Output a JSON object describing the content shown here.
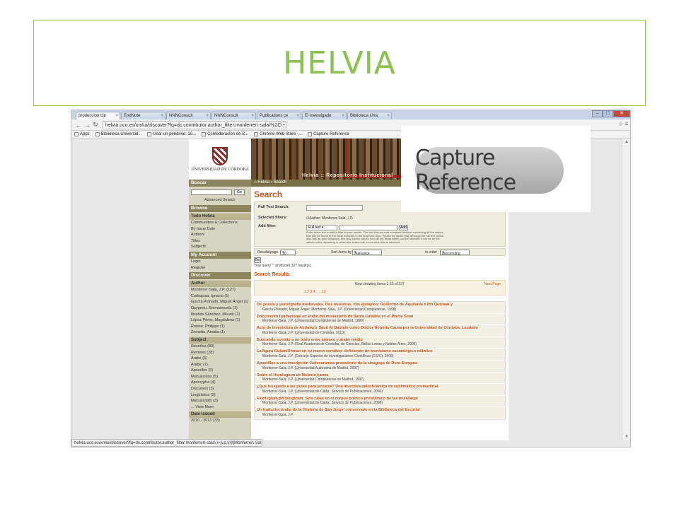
{
  "slide": {
    "title": "HELVIA"
  },
  "browser": {
    "tabs": [
      {
        "label": "produccion cie"
      },
      {
        "label": "EndNote"
      },
      {
        "label": "NNNConsult"
      },
      {
        "label": "NNNConsult"
      },
      {
        "label": "Publications ce"
      },
      {
        "label": "El investigado"
      },
      {
        "label": "Biblioteca Univ"
      }
    ],
    "url": "helvia.uco.es/xmlui/discover?fq=dc.contributor.author_filter:monferrer\\-sala\\%2C\\+j\\.p.\\|\\|\\|Monferrer\\-Sala\\%2C\\+J.P.",
    "bookmarks": [
      "Apps",
      "Biblioteca Universid...",
      "Usar un pendrive: 10...",
      "Confederación de S...",
      "Chrome Web Store -...",
      "Capture Reference"
    ],
    "status_url": "helvia.uco.es/xmlui/discover?fq=dc.contributor.author_filter:monferrer\\-sala\\,\\+j\\.p.\\|\\|\\|Monferrer\\-Sala\\,\\+J.P."
  },
  "site": {
    "logo_text": "UNIVERSIDAD DE CÓRDOBA",
    "banner_title": "Helvia :: Repositorio Institucional",
    "breadcrumb": [
      "Helvia",
      "Search"
    ]
  },
  "sidebar": {
    "buscar": "Buscar",
    "go": "Go",
    "advanced": "Advanced Search",
    "browse": "Browse",
    "todo_helvia": "Todo Helvia",
    "browse_items": [
      "Communities & Collections",
      "By Issue Date",
      "Authors",
      "Titles",
      "Subjects"
    ],
    "my_account": "My Account",
    "account_items": [
      "Login",
      "Register"
    ],
    "discover": "Discover",
    "author": "Author",
    "author_items": [
      "Monferrer-Sala, J.P. (127)",
      "Carbajosa, Ignacio (1)",
      "García Peinado, Miguel Ángel (1)",
      "Gzypeou, Emmanouela (1)",
      "Ibrahim Sánchez, Mounir (1)",
      "López Pérez, Magdalena (1)",
      "Roisse, Philippe (1)",
      "Zomeño, Amalia (1)"
    ],
    "subject": "Subject",
    "subject_items": [
      "Reseñas (83)",
      "Reviews (28)",
      "Árabe (6)",
      "Arabic (7)",
      "Apócrifos (5)",
      "Manuscritos (5)",
      "Apocrypha (4)",
      "Discursos (3)",
      "Lingüística (3)",
      "Manuscripts (3)",
      "... View More"
    ],
    "date_issued": "Date Issued",
    "date_items": [
      "2010 - 2013 (33)"
    ]
  },
  "main": {
    "heading": "Search",
    "full_text_label": "Full Text Search:",
    "selected_filters_label": "Selected filters:",
    "selected_filter_value": "Author: Monferrer-Sala, J.P.",
    "add_filter_label": "Add filter:",
    "add_filter_select": "Full text",
    "add_button": "Add",
    "filter_help": "Enter some text to add a filter to your results. The box has an auto-complete function containing all the values that can be found in the fields selected in the dropdown box. Please be aware that although the full text option also has an auto complete, this only shows values from all the fields which can be selected & not for all the values in the repository in which the search will occur when this is selected.",
    "results_page_label": "Results/page",
    "results_page_value": "10",
    "sort_label": "Sort items by",
    "sort_value": "relevance",
    "order_label": "in order",
    "order_value": "descending",
    "go_button": "Go",
    "query_text": "Your query \"\" produced 127 result(s).",
    "results_heading": "Search Results",
    "showing": "Now showing items 1-10 of 127",
    "next_page": "Next Page",
    "pages": "1  2  3  4  . . . 13",
    "results": [
      {
        "title": "De poesía y pornografía medievales. Dos muestras, dos ejemplos: Guillermo de Aquitania e Ibn Quzman y",
        "authors": "García Peinado, Miguel Ángel; Monferrer-Sala, J.P. (Universidad Complutense, 1998)"
      },
      {
        "title": "Documento fundacional en árabe del monasterio de Santa Catalina en el Monte Sinaí",
        "authors": "Monferrer-Sala, J.P. (Universidad Complutense de Madrid, 1999)"
      },
      {
        "title": "Acto de Investidura de Abdulaziz Saud Al Babtain como Doctor Honoris Causa por la Universidad de Córdoba. Laudatio",
        "authors": "Monferrer-Sala, J.P. (Universidad de Córdoba, 2013)"
      },
      {
        "title": "Buscando sentido a un texto entre arameo y árabe medio",
        "authors": "Monferrer-Sala, J.P. (Real Academia de Córdoba, de Ciencias, Bellas Letras y Nobles Artes, 2006)"
      },
      {
        "title": "La figura Gulam/Ghman en su marco semítico: definiendo un tecnicismo escatológico islámico",
        "authors": "Monferrer-Sala, J.P. (Consejo Superior de Investigaciones Científicas (CSIC), 2008)"
      },
      {
        "title": "Apostillas a una inscripción Judeoaramea procedente de la sinagoga de Dura-Europos",
        "authors": "Monferrer-Sala, J.P. (Universidad Autónoma de Madrid, 2007)"
      },
      {
        "title": "Sobre el Horologium de Melecio karma",
        "authors": "Monferrer-Sala, J.P. (Universidad Complutense de Madrid, 1997)"
      },
      {
        "title": "¿Qué les queda a las putas para jactarse? Una invectiva paleoislámica de sublimática promartirial",
        "authors": "Monferrer-Sala, J.P. (Universidad de Cádiz, Servicio de Publicaciones, 2006)"
      },
      {
        "title": "Florilegium philologicum. Seis calas en el corpus poético preislámico de las mu'allaqat",
        "authors": "Monferrer-Sala, J.P. (Universidad de Cádiz, Servicio de Publicaciones, 2008)"
      },
      {
        "title": "Un traductor árabe de la 'Historia de San Jorge' conservado en la Biblioteca del Escorial",
        "authors": "Monferrer-Sala, J.P."
      }
    ]
  },
  "capture_overlay": {
    "label": "Capture Reference"
  }
}
